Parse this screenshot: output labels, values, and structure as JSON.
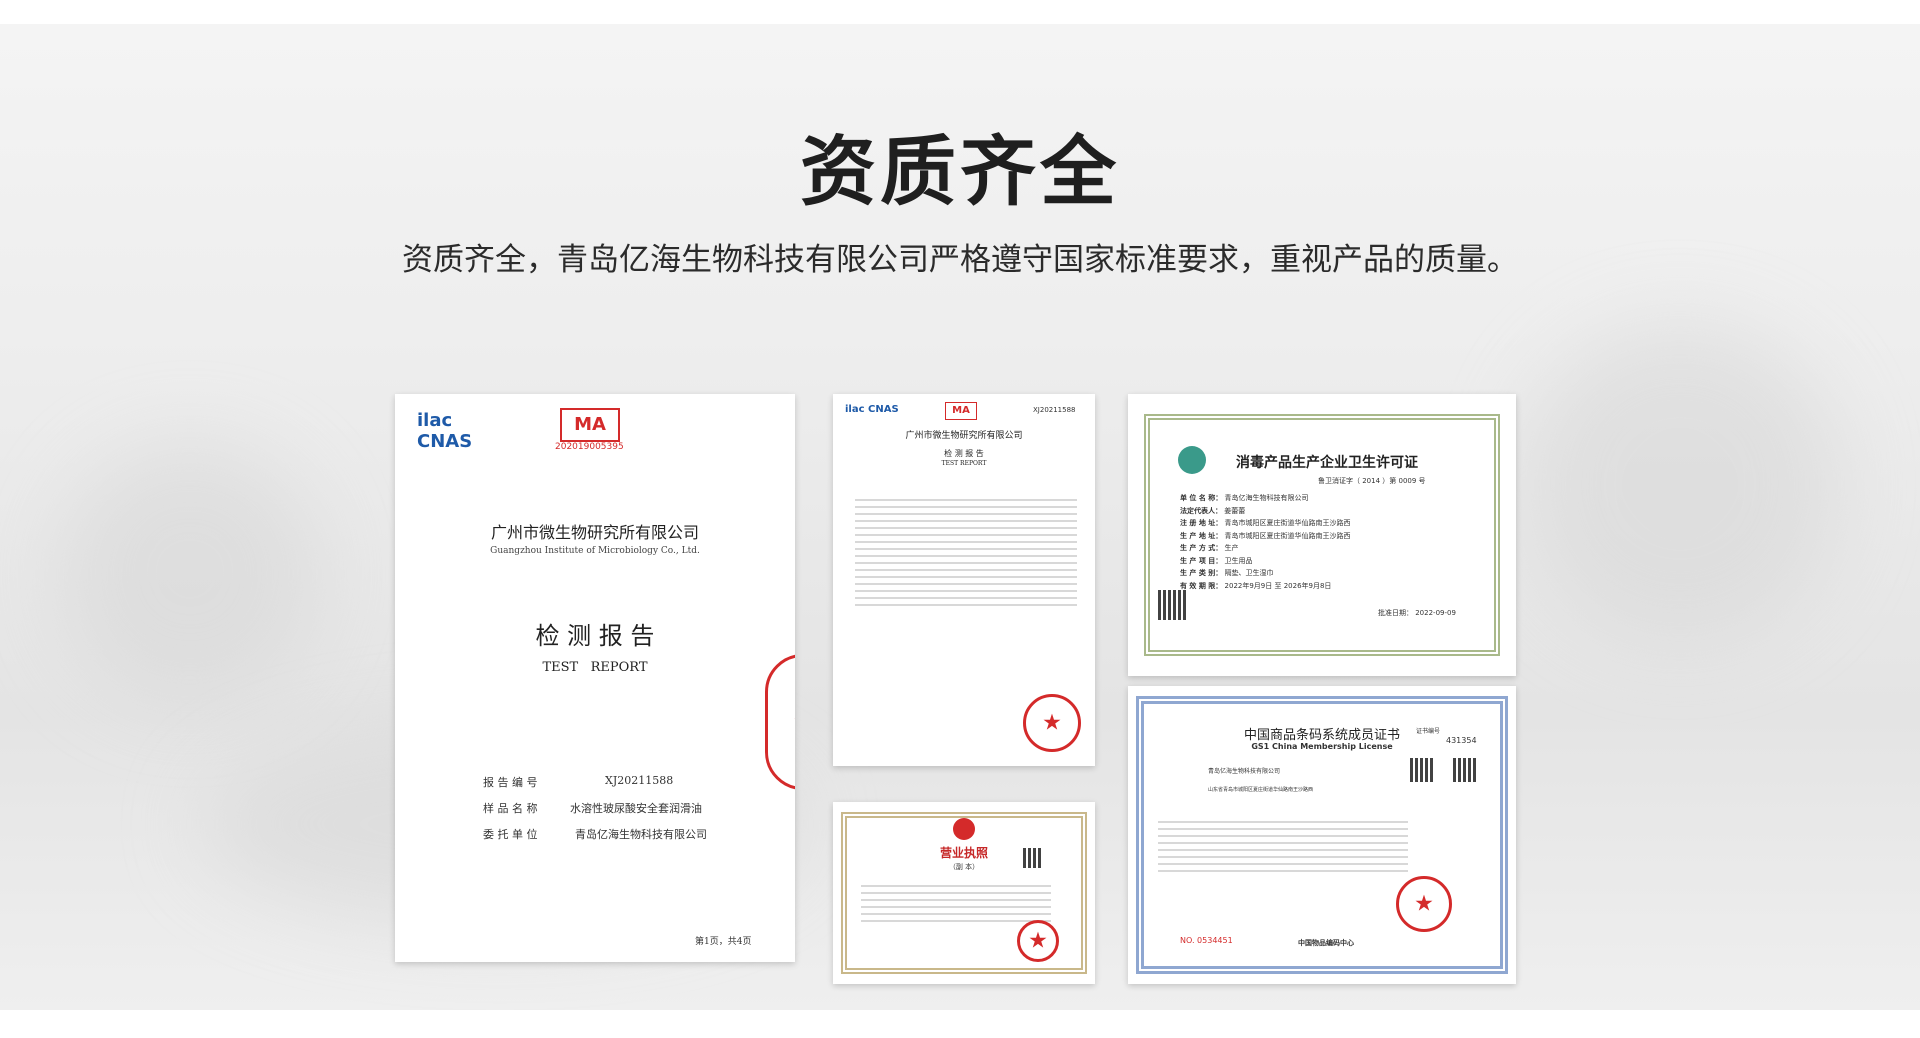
{
  "section": {
    "title": "资质齐全",
    "subtitle": "资质齐全，青岛亿海生物科技有限公司严格遵守国家标准要求，重视产品的质量。"
  },
  "certificates": {
    "test_report_cover": {
      "institute_cn": "广州市微生物研究所有限公司",
      "institute_en": "Guangzhou Institute of Microbiology Co., Ltd.",
      "doc_title_cn": "检 测 报 告",
      "doc_title_en": "TEST   REPORT",
      "cma_number": "202019005395",
      "field_report_no_label": "报 告 编 号",
      "field_report_no_value": "XJ20211588",
      "field_sample_label": "样 品 名 称",
      "field_sample_value": "水溶性玻尿酸安全套润滑油",
      "field_client_label": "委 托 单 位",
      "field_client_value": "青岛亿海生物科技有限公司",
      "page_info": "第1页，共4页"
    },
    "test_report_detail": {
      "institute_cn": "广州市微生物研究所有限公司",
      "doc_title_cn": "检 测 报 告",
      "doc_title_en": "TEST REPORT",
      "report_no": "XJ20211588"
    },
    "disinfection_permit": {
      "title": "消毒产品生产企业卫生许可证",
      "number": "鲁卫消证字（ 2014 ）第 0009 号",
      "company": "青岛亿海生物科技有限公司",
      "legal_rep": "姜蕾蕾",
      "reg_address": "青岛市城阳区夏庄街道华仙路南王沙路西",
      "prod_address": "青岛市城阳区夏庄街道华仙路南王沙路西",
      "prod_method": "生产",
      "prod_items": "卫生用品",
      "prod_class": "隔垫、卫生湿巾",
      "valid": "2022年9月9日 至 2026年9月8日",
      "issue_date": "批准日期： 2022-09-09",
      "rows": [
        {
          "label": "单 位 名 称：",
          "key": "company"
        },
        {
          "label": "法定代表人：",
          "key": "legal_rep"
        },
        {
          "label": "注 册 地 址：",
          "key": "reg_address"
        },
        {
          "label": "生 产 地 址：",
          "key": "prod_address"
        },
        {
          "label": "生 产 方 式：",
          "key": "prod_method"
        },
        {
          "label": "生 产 项 目：",
          "key": "prod_items"
        },
        {
          "label": "生 产 类 别：",
          "key": "prod_class"
        },
        {
          "label": "有 效 期 限：",
          "key": "valid"
        }
      ]
    },
    "business_license": {
      "title": "营业执照",
      "copy_label": "（副 本）"
    },
    "gs1_certificate": {
      "title_cn": "中国商品条码系统成员证书",
      "title_en": "GS1 China Membership License",
      "cert_no_label": "证书编号",
      "cert_no": "431354",
      "company": "青岛亿海生物科技有限公司",
      "address": "山东省青岛市城阳区夏庄街道华仙路南王沙路西",
      "serial": "NO. 0534451",
      "issuer": "中国物品编码中心"
    }
  },
  "colors": {
    "title": "#1f1f1f",
    "seal_red": "#d42a2a",
    "permit_border": "#a9b98a",
    "gs1_border": "#8fa7d1"
  }
}
